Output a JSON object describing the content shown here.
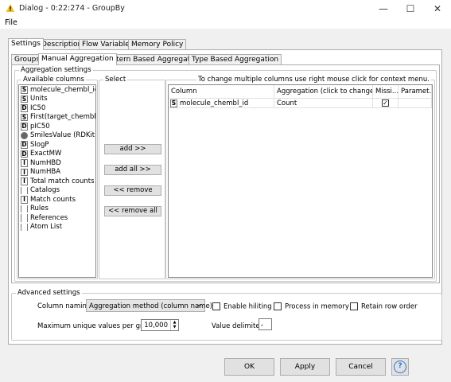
{
  "window": {
    "title": "Dialog - 0:22:274 - GroupBy",
    "minimize": "—",
    "maximize": "☐",
    "close": "✕"
  },
  "menu": {
    "file": "File"
  },
  "tabs": [
    "Settings",
    "Description",
    "Flow Variables",
    "Memory Policy"
  ],
  "subtabs": [
    "Groups",
    "Manual Aggregation",
    "Pattern Based Aggregation",
    "Type Based Aggregation"
  ],
  "aggregation": {
    "legend": "Aggregation settings",
    "available_legend": "Available columns",
    "columns": [
      {
        "type": "S",
        "name": "molecule_chembl_id"
      },
      {
        "type": "S",
        "name": "Units"
      },
      {
        "type": "D",
        "name": "IC50"
      },
      {
        "type": "S",
        "name": "First(target_chembl_id"
      },
      {
        "type": "D",
        "name": "pIC50"
      },
      {
        "type": "circle",
        "name": "SmilesValue (RDKit M"
      },
      {
        "type": "D",
        "name": "SlogP"
      },
      {
        "type": "D",
        "name": "ExactMW"
      },
      {
        "type": "I",
        "name": "NumHBD"
      },
      {
        "type": "I",
        "name": "NumHBA"
      },
      {
        "type": "I",
        "name": "Total match counts"
      },
      {
        "type": "[..]",
        "name": "Catalogs"
      },
      {
        "type": "I",
        "name": "Match counts"
      },
      {
        "type": "[..]",
        "name": "Rules"
      },
      {
        "type": "[..]",
        "name": "References"
      },
      {
        "type": "[..]",
        "name": "Atom List"
      }
    ],
    "select_legend": "Select",
    "buttons": {
      "add": "add >>",
      "add_all": "add all >>",
      "remove": "<< remove",
      "remove_all": "<< remove all"
    },
    "table_legend": "To change multiple columns use right mouse click for context menu.",
    "headers": [
      "Column",
      "Aggregation (click to change)",
      "Missi...",
      "Paramet..."
    ],
    "rows": [
      {
        "type": "S",
        "column": "molecule_chembl_id",
        "aggregation": "Count",
        "missing": true,
        "parameter": ""
      }
    ]
  },
  "advanced": {
    "legend": "Advanced settings",
    "naming_label": "Column naming:",
    "naming_value": "Aggregation method (column name)",
    "enable_hiliting": "Enable hiliting",
    "process_memory": "Process in memory",
    "retain_order": "Retain row order",
    "max_unique_label": "Maximum unique values per group",
    "max_unique_value": "10,000",
    "delimiter_label": "Value delimiter",
    "delimiter_value": ","
  },
  "footer": {
    "ok": "OK",
    "apply": "Apply",
    "cancel": "Cancel",
    "help": "?"
  }
}
